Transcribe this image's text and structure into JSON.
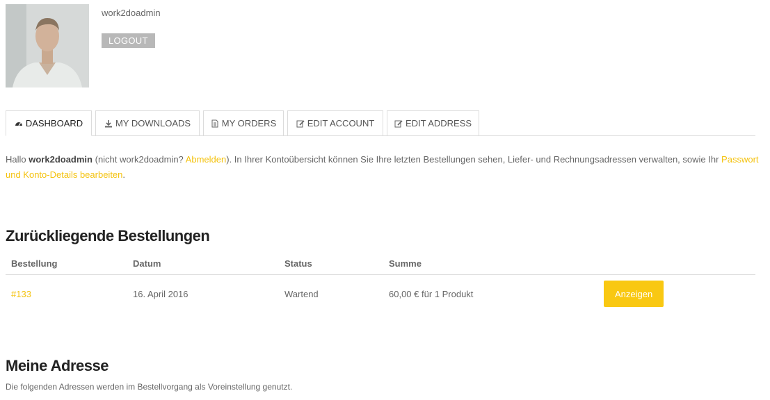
{
  "profile": {
    "username": "work2doadmin",
    "logout_label": "LOGOUT"
  },
  "tabs": [
    {
      "label": "DASHBOARD",
      "icon": "dashboard-icon",
      "active": true
    },
    {
      "label": "MY DOWNLOADS",
      "icon": "download-icon",
      "active": false
    },
    {
      "label": "MY ORDERS",
      "icon": "document-icon",
      "active": false
    },
    {
      "label": "EDIT ACCOUNT",
      "icon": "edit-icon",
      "active": false
    },
    {
      "label": "EDIT ADDRESS",
      "icon": "edit-icon",
      "active": false
    }
  ],
  "intro": {
    "hello": "Hallo ",
    "user": "work2doadmin",
    "not_user_prefix": " (nicht work2doadmin? ",
    "logout_link": "Abmelden",
    "text": "). In Ihrer Kontoübersicht können Sie Ihre letzten Bestellungen sehen, Liefer- und Rechnungsadressen verwalten, sowie Ihr ",
    "edit_link": "Passwort und Konto-Details bearbeiten",
    "end": "."
  },
  "orders": {
    "heading": "Zurückliegende Bestellungen",
    "columns": [
      "Bestellung",
      "Datum",
      "Status",
      "Summe"
    ],
    "rows": [
      {
        "order": "#133",
        "date": "16. April 2016",
        "status": "Wartend",
        "total": "60,00 € für 1 Produkt",
        "action": "Anzeigen"
      }
    ]
  },
  "address": {
    "heading": "Meine Adresse",
    "note": "Die folgenden Adressen werden im Bestellvorgang als Voreinstellung genutzt."
  },
  "colors": {
    "accent": "#f9c812",
    "link": "#f4c20d",
    "logout_bg": "#b8b8b8"
  }
}
